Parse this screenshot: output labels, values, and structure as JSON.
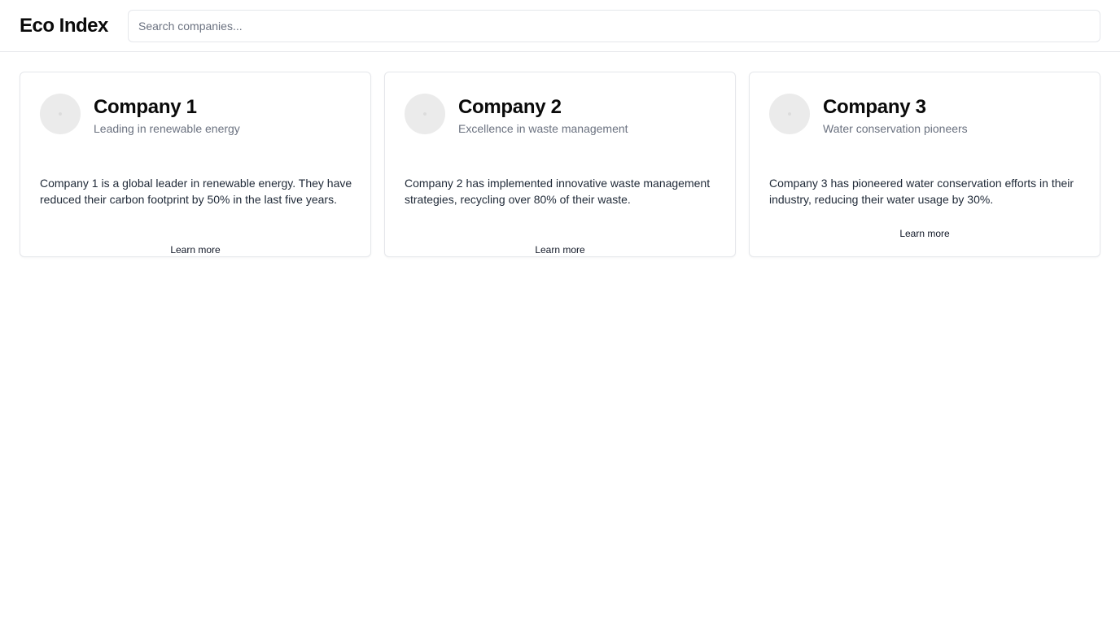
{
  "header": {
    "brand": "Eco Index",
    "search_placeholder": "Search companies...",
    "search_value": ""
  },
  "companies": [
    {
      "name": "Company 1",
      "tagline": "Leading in renewable energy",
      "description": "Company 1 is a global leader in renewable energy. They have reduced their carbon footprint by 50% in the last five years.",
      "link_label": "Learn more"
    },
    {
      "name": "Company 2",
      "tagline": "Excellence in waste management",
      "description": "Company 2 has implemented innovative waste management strategies, recycling over 80% of their waste.",
      "link_label": "Learn more"
    },
    {
      "name": "Company 3",
      "tagline": "Water conservation pioneers",
      "description": "Company 3 has pioneered water conservation efforts in their industry, reducing their water usage by 30%.",
      "link_label": "Learn more"
    }
  ],
  "icons": {
    "avatar": "company-logo-placeholder-icon"
  },
  "colors": {
    "border": "#e5e7eb",
    "muted_text": "#6b7280",
    "avatar_bg": "#ebebeb"
  }
}
